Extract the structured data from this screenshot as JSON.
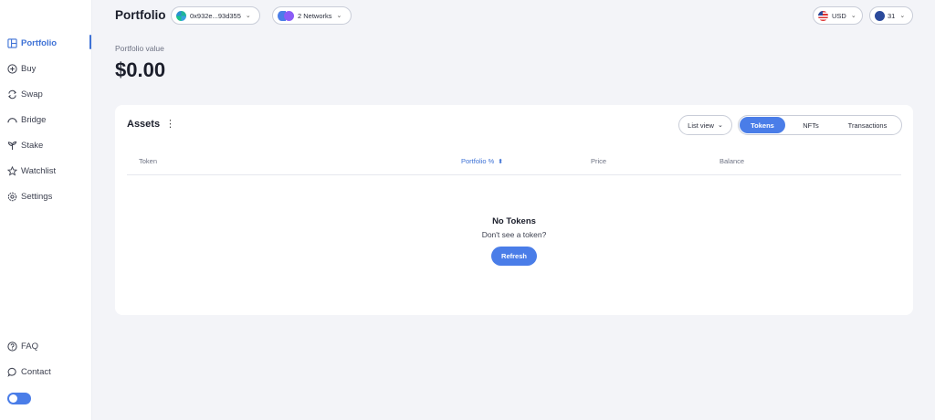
{
  "sidebar": {
    "items": [
      {
        "label": "Portfolio",
        "icon": "layout-icon",
        "active": true
      },
      {
        "label": "Buy",
        "icon": "plus-circle-icon"
      },
      {
        "label": "Swap",
        "icon": "swap-icon"
      },
      {
        "label": "Bridge",
        "icon": "bridge-icon"
      },
      {
        "label": "Stake",
        "icon": "sprout-icon"
      },
      {
        "label": "Watchlist",
        "icon": "star-icon"
      },
      {
        "label": "Settings",
        "icon": "gear-icon"
      }
    ],
    "footer": [
      {
        "label": "FAQ",
        "icon": "question-circle-icon"
      },
      {
        "label": "Contact",
        "icon": "chat-bubble-icon"
      }
    ],
    "theme_toggle": {
      "icon": "theme-toggle-icon",
      "on": true
    }
  },
  "header": {
    "title": "Portfolio",
    "wallet": "0x932e...93d355",
    "networks": "2 Networks",
    "currency": "USD",
    "account_count": "31"
  },
  "portfolio": {
    "label": "Portfolio value",
    "value": "$0.00"
  },
  "assets": {
    "title": "Assets",
    "view_select": "List view",
    "tabs": [
      "Tokens",
      "NFTs",
      "Transactions"
    ],
    "active_tab": "Tokens",
    "columns": [
      "Token",
      "Portfolio %",
      "Price",
      "Balance"
    ],
    "empty_title": "No Tokens",
    "empty_sub": "Don't see a token?",
    "refresh_label": "Refresh"
  },
  "colors": {
    "accent": "#4a7de8",
    "active_nav": "#3e72d6",
    "background": "#f3f4f8"
  }
}
